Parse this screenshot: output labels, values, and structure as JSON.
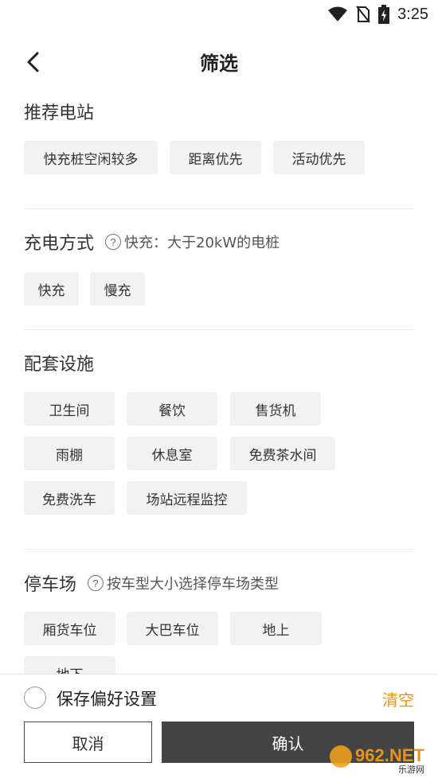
{
  "status_bar": {
    "time": "3:25",
    "icons": [
      "wifi-icon",
      "no-sim-icon",
      "battery-charging-icon"
    ]
  },
  "header": {
    "title": "筛选",
    "back_icon": "chevron-left-icon"
  },
  "sections": {
    "recommend": {
      "title": "推荐电站",
      "options": [
        "快充桩空闲较多",
        "距离优先",
        "活动优先"
      ]
    },
    "charge_mode": {
      "title": "充电方式",
      "hint": "快充：大于20kW的电桩",
      "options": [
        "快充",
        "慢充"
      ]
    },
    "facilities": {
      "title": "配套设施",
      "options": [
        "卫生间",
        "餐饮",
        "售货机",
        "雨棚",
        "休息室",
        "免费茶水间",
        "免费洗车",
        "场站远程监控"
      ]
    },
    "parking": {
      "title": "停车场",
      "hint": "按车型大小选择停车场类型",
      "options": [
        "厢货车位",
        "大巴车位",
        "地上",
        "地下"
      ]
    }
  },
  "footer": {
    "save_label": "保存偏好设置",
    "clear_label": "清空",
    "cancel_label": "取消",
    "confirm_label": "确认"
  },
  "watermark": {
    "brand": "962.NET",
    "sub": "乐游网"
  },
  "colors": {
    "accent": "#e8931a",
    "chip_bg": "#f2f2f2",
    "confirm_bg": "#444444"
  }
}
